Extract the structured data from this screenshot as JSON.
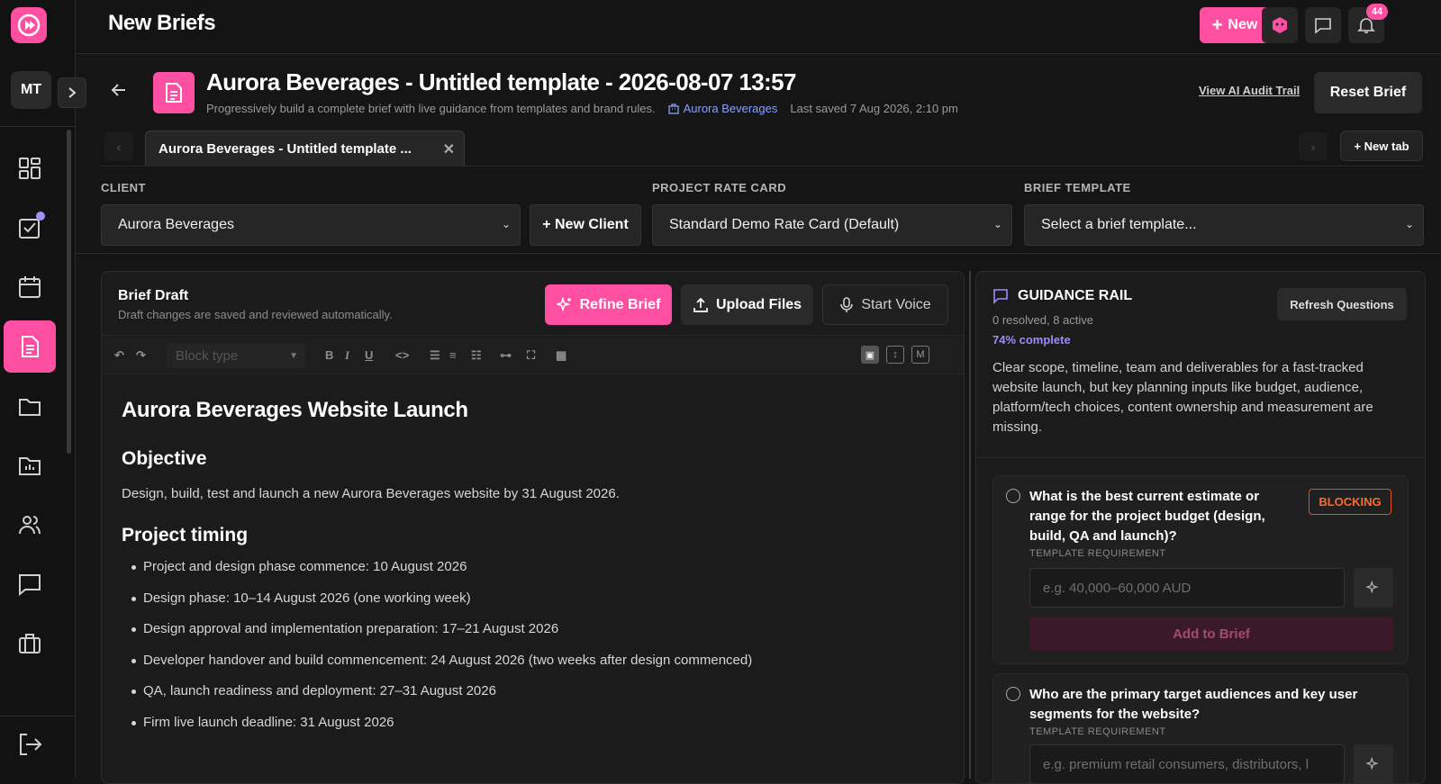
{
  "app": {
    "title": "New Briefs",
    "new_label": "New",
    "notifications_count": "44",
    "user_initials": "MT"
  },
  "page": {
    "title": "Aurora Beverages - Untitled template - 2026-08-07 13:57",
    "subtitle": "Progressively build a complete brief with live guidance from templates and brand rules.",
    "client_link": "Aurora Beverages",
    "last_saved": "Last saved 7 Aug 2026, 2:10 pm",
    "audit_link": "View AI Audit Trail",
    "reset_label": "Reset Brief"
  },
  "tabs": {
    "active_label": "Aurora Beverages - Untitled template ...",
    "new_tab_label": "+ New tab"
  },
  "fields": {
    "client_label": "CLIENT",
    "client_value": "Aurora Beverages",
    "new_client_label": "+ New Client",
    "rate_label": "PROJECT RATE CARD",
    "rate_value": "Standard Demo Rate Card (Default)",
    "template_label": "BRIEF TEMPLATE",
    "template_value": "Select a brief template..."
  },
  "editor": {
    "title": "Brief Draft",
    "subtitle": "Draft changes are saved and reviewed automatically.",
    "refine_label": "Refine Brief",
    "upload_label": "Upload Files",
    "voice_label": "Start Voice",
    "block_type_placeholder": "Block type",
    "doc_title": "Aurora Beverages Website Launch",
    "objective_heading": "Objective",
    "objective_text": "Design, build, test and launch a new Aurora Beverages website by 31 August 2026.",
    "timing_heading": "Project timing",
    "timing_items": [
      "Project and design phase commence: 10 August 2026",
      "Design phase: 10–14 August 2026 (one working week)",
      "Design approval and implementation preparation: 17–21 August 2026",
      "Developer handover and build commencement: 24 August 2026 (two weeks after design commenced)",
      "QA, launch readiness and deployment: 27–31 August 2026",
      "Firm live launch deadline: 31 August 2026"
    ]
  },
  "rail": {
    "title": "GUIDANCE RAIL",
    "refresh_label": "Refresh Questions",
    "resolved": "0 resolved, 8 active",
    "complete": "74% complete",
    "summary": "Clear scope, timeline, team and deliverables for a fast-tracked website launch, but key planning inputs like budget, audience, platform/tech choices, content ownership and measurement are missing.",
    "questions": [
      {
        "text": "What is the best current estimate or range for the project budget (design, build, QA and launch)?",
        "badge": "BLOCKING",
        "req": "TEMPLATE REQUIREMENT",
        "placeholder": "e.g. 40,000–60,000 AUD",
        "add_label": "Add to Brief"
      },
      {
        "text": "Who are the primary target audiences and key user segments for the website?",
        "req": "TEMPLATE REQUIREMENT",
        "placeholder": "e.g. premium retail consumers, distributors, l"
      }
    ]
  },
  "colors": {
    "accent": "#ff4fa3",
    "link": "#8aa0ff",
    "complete": "#9e8bff",
    "blocking": "#ff6a2a"
  }
}
